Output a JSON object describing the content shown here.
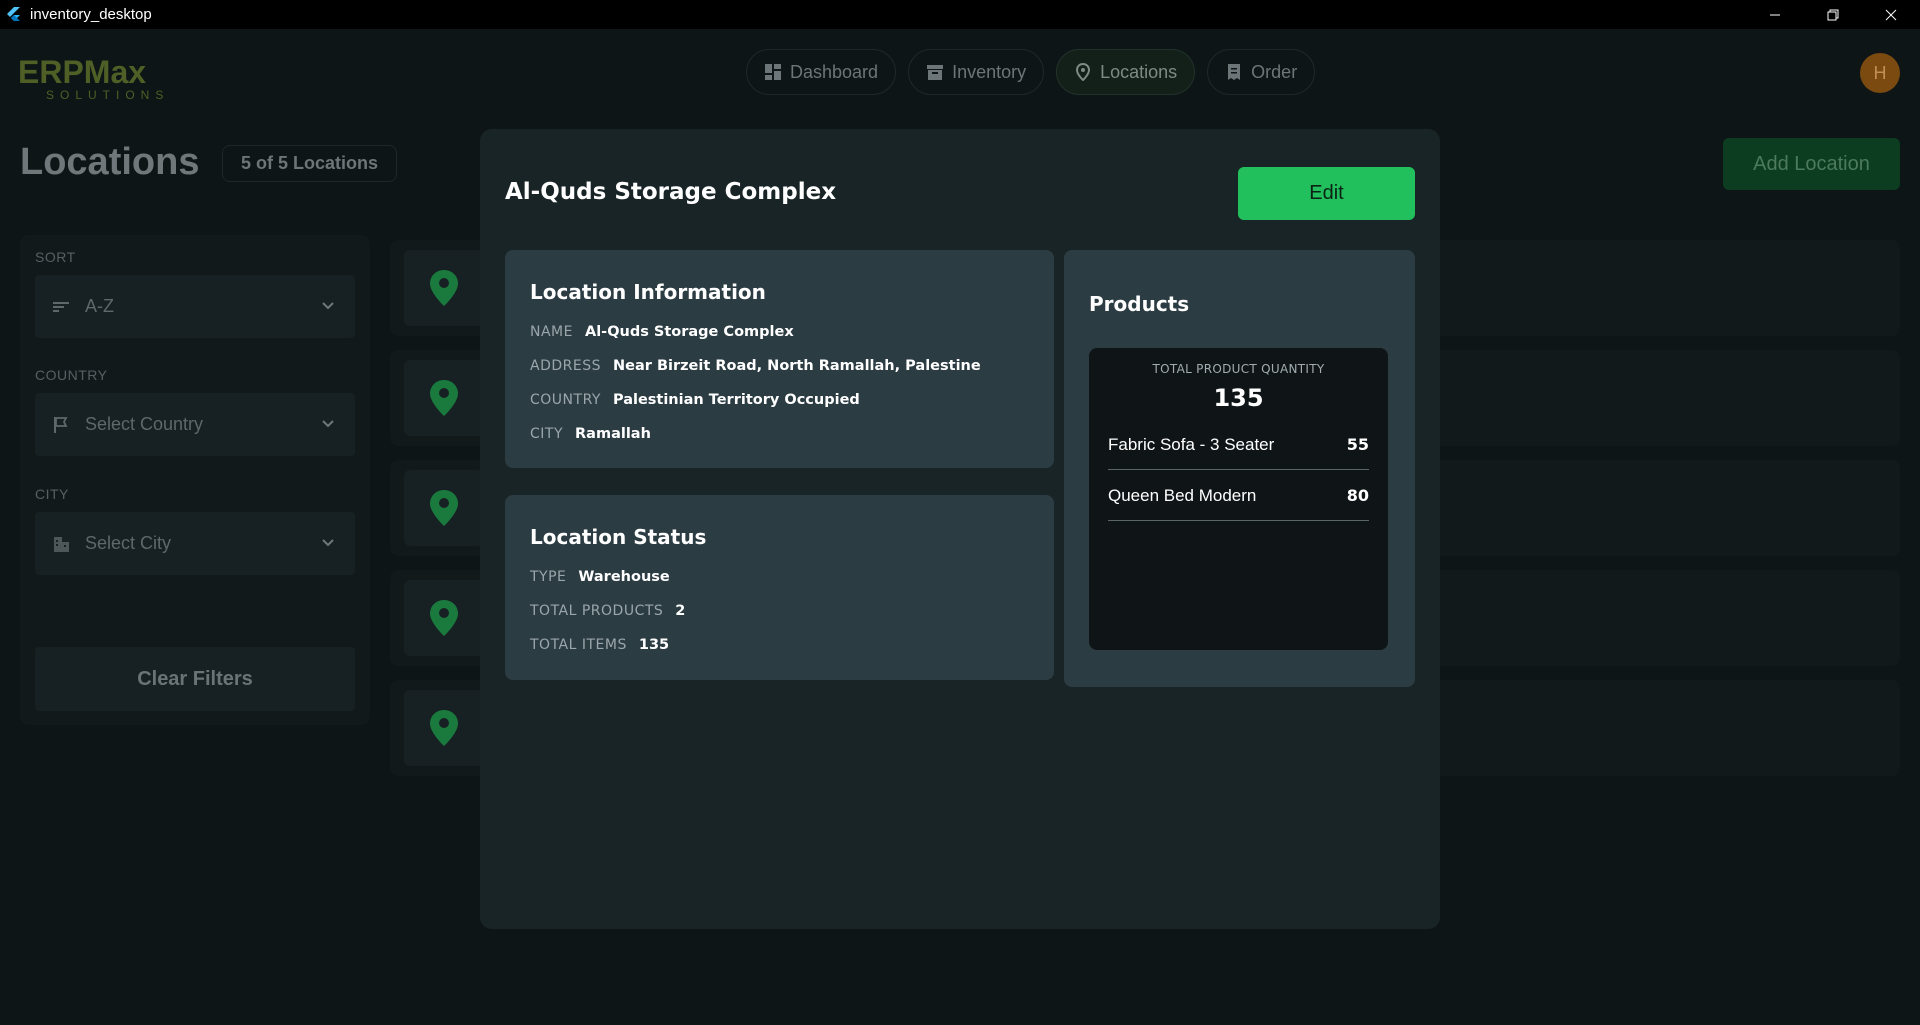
{
  "window": {
    "title": "inventory_desktop"
  },
  "nav": {
    "items": [
      {
        "label": "Dashboard",
        "icon": "dashboard-icon"
      },
      {
        "label": "Inventory",
        "icon": "archive-icon"
      },
      {
        "label": "Locations",
        "icon": "location-pin-icon",
        "active": true
      },
      {
        "label": "Order",
        "icon": "receipt-icon"
      }
    ],
    "avatar_initial": "H"
  },
  "page": {
    "title": "Locations",
    "count_badge": "5 of 5 Locations",
    "add_button": "Add Location"
  },
  "filters": {
    "sort_label": "SORT",
    "sort_value": "A-Z",
    "country_label": "COUNTRY",
    "country_placeholder": "Select Country",
    "city_label": "CITY",
    "city_placeholder": "Select City",
    "clear_button": "Clear Filters"
  },
  "modal": {
    "title": "Al-Quds Storage Complex",
    "edit_button": "Edit",
    "location_info": {
      "title": "Location Information",
      "rows": [
        {
          "key": "NAME",
          "value": "Al-Quds Storage Complex"
        },
        {
          "key": "ADDRESS",
          "value": "Near Birzeit Road, North Ramallah, Palestine"
        },
        {
          "key": "COUNTRY",
          "value": "Palestinian Territory Occupied"
        },
        {
          "key": "CITY",
          "value": "Ramallah"
        }
      ]
    },
    "location_status": {
      "title": "Location Status",
      "rows": [
        {
          "key": "TYPE",
          "value": "Warehouse"
        },
        {
          "key": "TOTAL PRODUCTS",
          "value": "2"
        },
        {
          "key": "TOTAL ITEMS",
          "value": "135"
        }
      ]
    },
    "products": {
      "title": "Products",
      "total_label": "TOTAL PRODUCT QUANTITY",
      "total_value": "135",
      "items": [
        {
          "name": "Fabric Sofa - 3 Seater",
          "qty": "55"
        },
        {
          "name": "Queen Bed Modern",
          "qty": "80"
        }
      ]
    }
  },
  "colors": {
    "accent_green": "#22c05c",
    "panel": "#2c3c43",
    "modal": "#192427"
  }
}
